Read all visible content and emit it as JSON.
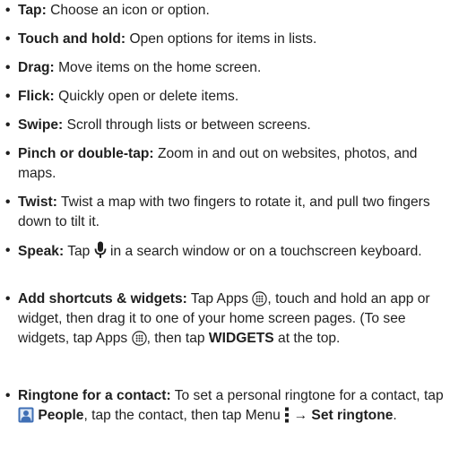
{
  "bullet": "•",
  "items": [
    {
      "term": "Tap:",
      "desc": " Choose an icon or option."
    },
    {
      "term": "Touch and hold:",
      "desc": " Open options for items in lists."
    },
    {
      "term": "Drag:",
      "desc": " Move items on the home screen."
    },
    {
      "term": "Flick:",
      "desc": " Quickly open or delete items."
    },
    {
      "term": "Swipe:",
      "desc": " Scroll through lists or between screens."
    },
    {
      "term": "Pinch or double-tap:",
      "desc": " Zoom in and out on websites, photos, and maps."
    },
    {
      "term": "Twist:",
      "desc": " Twist a map with two fingers to rotate it, and pull two fingers down to tilt it."
    },
    {
      "term": "Speak:",
      "desc_a": " Tap ",
      "desc_b": " in a search window or on a touchscreen keyboard."
    },
    {
      "term": "Add shortcuts & widgets:",
      "desc_a": " Tap Apps ",
      "desc_b": ", touch and hold an app or widget, then drag it to one of your home screen pages. (To see widgets, tap Apps ",
      "desc_c": ", then tap ",
      "bold": "WIDGETS",
      "desc_d": " at the top."
    },
    {
      "term": "Ringtone for a contact:",
      "desc_a": " To set a personal ringtone for a contact, tap ",
      "bold": "People",
      "desc_b": ", tap the contact, then tap Menu ",
      "desc_c": " → ",
      "bold2": "Set ringtone",
      "desc_d": "."
    }
  ],
  "icons": {
    "mic": "microphone-icon",
    "apps": "apps-icon",
    "people": "people-icon",
    "menu": "menu-dots-icon"
  },
  "colors": {
    "text": "#1f1f1f",
    "mic": "#1f1f1f",
    "people": "#3f6fb5"
  }
}
